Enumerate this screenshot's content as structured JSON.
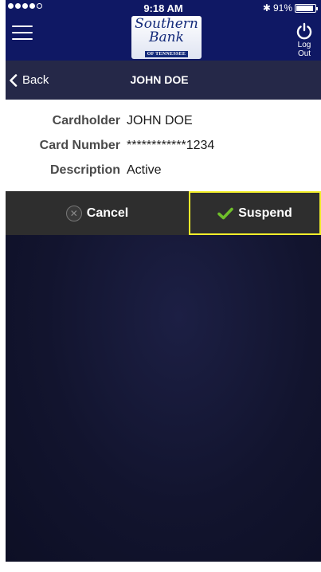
{
  "status_bar": {
    "time": "9:18 AM",
    "battery_percent": "91%",
    "battery_level": 0.91,
    "signal_filled": 4,
    "signal_total": 5
  },
  "app_bar": {
    "logo": {
      "line1": "Southern",
      "line2": "Bank",
      "line3": "OF TENNESSEE"
    },
    "logout_label": "Log Out"
  },
  "nav": {
    "back_label": "Back",
    "title": "JOHN DOE"
  },
  "card_details": [
    {
      "label": "Cardholder",
      "value": "JOHN DOE"
    },
    {
      "label": "Card Number",
      "value": "************1234"
    },
    {
      "label": "Description",
      "value": "Active"
    }
  ],
  "actions": {
    "cancel_label": "Cancel",
    "suspend_label": "Suspend"
  },
  "colors": {
    "header_bg": "#0f1864",
    "nav_bg": "#252848",
    "action_bar_bg": "#2e2e2e",
    "highlight_border": "#f2ee2a",
    "check_green": "#6fbf2a"
  }
}
